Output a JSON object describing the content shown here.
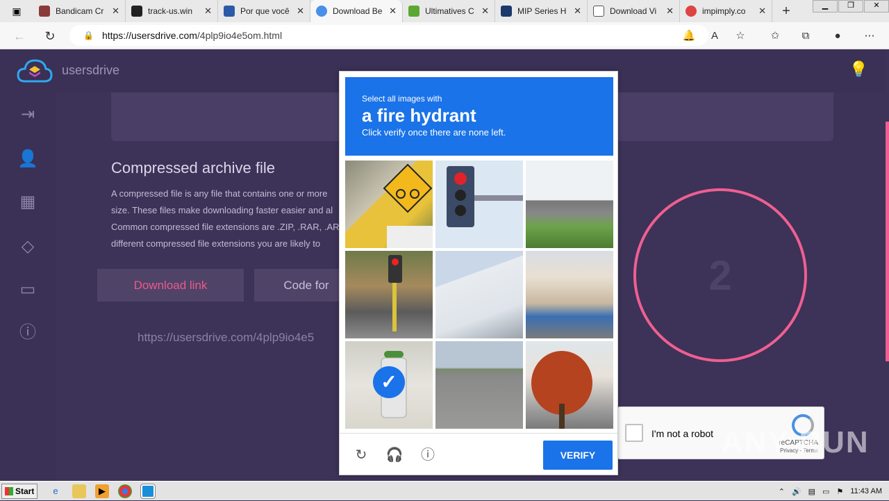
{
  "browser": {
    "tabs": [
      {
        "label": "Bandicam Cr",
        "favicon_color": "#8b3a3a"
      },
      {
        "label": "track-us.win",
        "favicon_color": "#222222"
      },
      {
        "label": "Por que você",
        "favicon_color": "#2b5aa8"
      },
      {
        "label": "Download Be",
        "favicon_color": "#4a8fe8",
        "active": true
      },
      {
        "label": "Ultimatives C",
        "favicon_color": "#5aa832"
      },
      {
        "label": "MIP Series H",
        "favicon_color": "#1b3a6b"
      },
      {
        "label": "Download Vi",
        "favicon_color": "#dddddd"
      },
      {
        "label": "impimply.co",
        "favicon_color": "#d44"
      }
    ],
    "url_host": "https://usersdrive.com",
    "url_path": "/4plp9io4e5om.html"
  },
  "site": {
    "brand": "usersdrive",
    "archive_title": "Compressed archive file",
    "archive_lines": [
      "A compressed file is any file that contains one or more",
      "size. These files make downloading faster easier and al",
      "Common compressed file extensions are .ZIP, .RAR, .AR",
      "different compressed file extensions you are likely to"
    ],
    "download_label": "Download link",
    "code_label": "Code for",
    "page_url": "https://usersdrive.com/4plp9io4e5",
    "countdown": "2",
    "accent_color": "#ef5f92"
  },
  "recaptcha": {
    "select_text": "Select all images with",
    "object": "a fire hydrant",
    "instruction": "Click verify once there are none left.",
    "verify_label": "VERIFY",
    "tiles": [
      {
        "name": "tile-bicycle-sign",
        "selected": false
      },
      {
        "name": "tile-traffic-light",
        "selected": false
      },
      {
        "name": "tile-overpass",
        "selected": false
      },
      {
        "name": "tile-street-traffic-light",
        "selected": false
      },
      {
        "name": "tile-building",
        "selected": false
      },
      {
        "name": "tile-house",
        "selected": false
      },
      {
        "name": "tile-fire-hydrant",
        "selected": true
      },
      {
        "name": "tile-road",
        "selected": false
      },
      {
        "name": "tile-tree",
        "selected": false
      }
    ]
  },
  "widget": {
    "label": "I'm not a robot",
    "brand": "reCAPTCHA",
    "links": "Privacy - Terms"
  },
  "watermark": "ANY RUN",
  "taskbar": {
    "start_label": "Start",
    "clock": "11:43 AM"
  }
}
